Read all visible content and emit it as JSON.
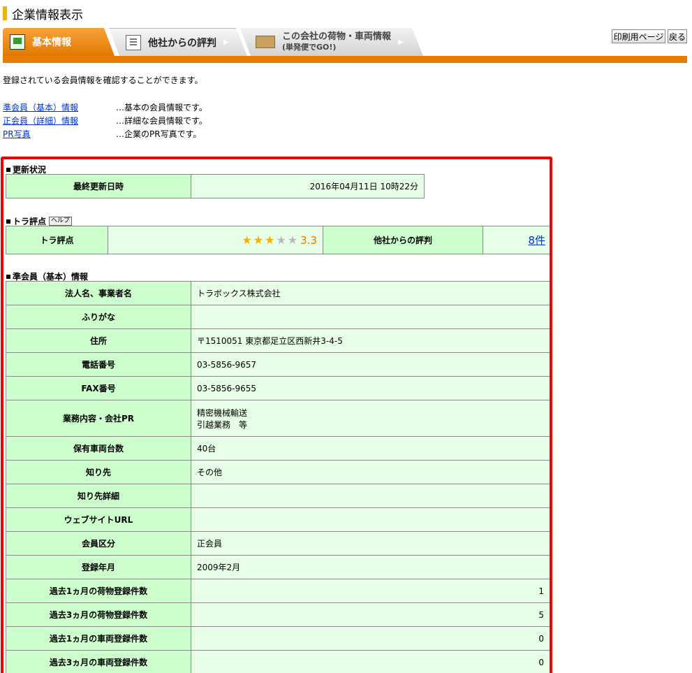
{
  "page_title": "企業情報表示",
  "tabs": [
    {
      "label": "基本情報"
    },
    {
      "label": "他社からの評判"
    },
    {
      "label": "この会社の荷物・車両情報",
      "sub": "(単発便でGO!)"
    }
  ],
  "buttons": {
    "print": "印刷用ページ",
    "back": "戻る"
  },
  "intro": "登録されている会員情報を確認することができます。",
  "links": [
    {
      "label": "準会員（基本）情報",
      "desc": "…基本の会員情報です。"
    },
    {
      "label": "正会員（詳細）情報",
      "desc": "…詳細な会員情報です。"
    },
    {
      "label": "PR写真",
      "desc": "…企業のPR写真です。"
    }
  ],
  "update": {
    "heading": "更新状況",
    "label": "最終更新日時",
    "value": "2016年04月11日 10時22分"
  },
  "rating": {
    "heading": "トラ評点",
    "help": "ヘルプ",
    "label": "トラ評点",
    "stars": 3,
    "max_stars": 5,
    "score": "3.3",
    "reviews_label": "他社からの評判",
    "reviews_count": "8件"
  },
  "basic": {
    "heading": "準会員（基本）情報",
    "rows": [
      {
        "label": "法人名、事業者名",
        "value": "トラボックス株式会社"
      },
      {
        "label": "ふりがな",
        "value": ""
      },
      {
        "label": "住所",
        "value": "〒1510051 東京都足立区西新井3-4-5"
      },
      {
        "label": "電話番号",
        "value": "03-5856-9657"
      },
      {
        "label": "FAX番号",
        "value": "03-5856-9655"
      },
      {
        "label": "業務内容・会社PR",
        "value": "精密機械輸送",
        "value2": "引越業務　等"
      },
      {
        "label": "保有車両台数",
        "value": "40台"
      },
      {
        "label": "知り先",
        "value": "その他"
      },
      {
        "label": "知り先詳細",
        "value": ""
      },
      {
        "label": "ウェブサイトURL",
        "value": ""
      },
      {
        "label": "会員区分",
        "value": "正会員"
      },
      {
        "label": "登録年月",
        "value": "2009年2月"
      },
      {
        "label": "過去1ヵ月の荷物登録件数",
        "value": "1"
      },
      {
        "label": "過去3ヵ月の荷物登録件数",
        "value": "5"
      },
      {
        "label": "過去1ヵ月の車両登録件数",
        "value": "0"
      },
      {
        "label": "過去3ヵ月の車両登録件数",
        "value": "0"
      }
    ]
  }
}
